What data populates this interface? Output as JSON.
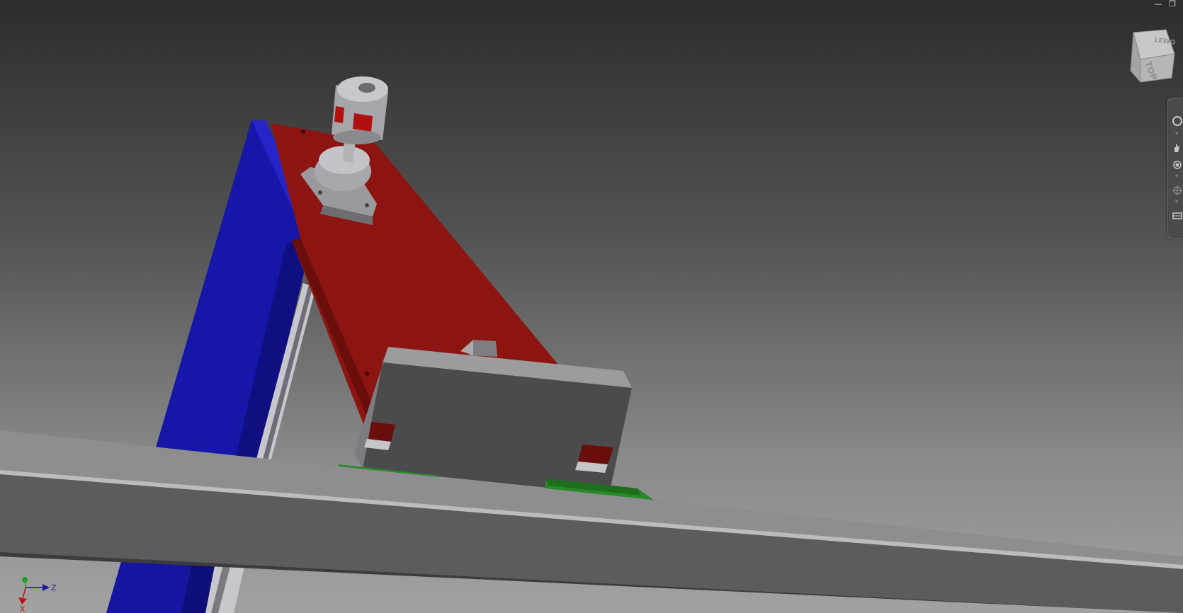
{
  "window": {
    "minimize_glyph": "—",
    "restore_glyph": "❐"
  },
  "viewcube": {
    "top_label": "TOP",
    "edge_label": "LEWO"
  },
  "nav_bar": {
    "items": [
      {
        "icon": "steering-wheel-icon"
      },
      {
        "icon": "pan-icon"
      },
      {
        "icon": "zoom-icon"
      },
      {
        "icon": "orbit-icon"
      },
      {
        "icon": "look-at-icon"
      }
    ]
  },
  "triad": {
    "z_label": "Z",
    "x_label": "X"
  },
  "colors": {
    "background_top": "#2c2c2c",
    "background_bottom": "#a2a2a2",
    "frame_blue": "#1515a0",
    "plate_red": "#8c1512",
    "rail_gray": "#6e6e6e",
    "carriage_dark": "#4b4b4d",
    "linear_block_green": "#2a8a2a",
    "axis_z": "#1a1aa0",
    "axis_y": "#20a020",
    "axis_x": "#c01010"
  }
}
